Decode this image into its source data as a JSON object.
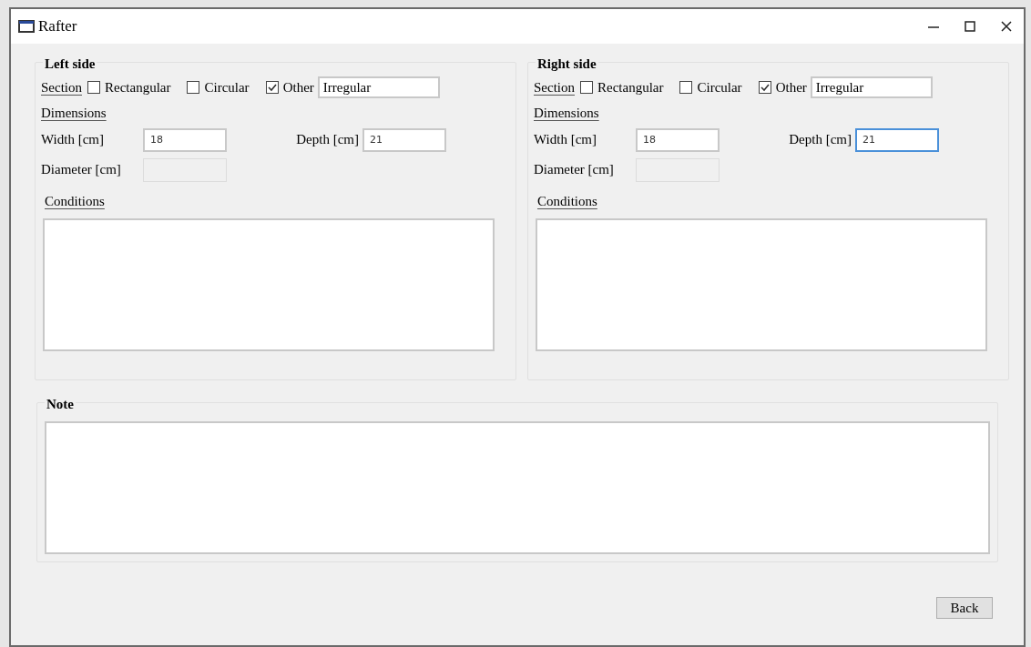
{
  "window": {
    "title": "Rafter"
  },
  "sides": [
    {
      "title": "Left side",
      "section_label": "Section",
      "options": [
        {
          "label": "Rectangular",
          "checked": false
        },
        {
          "label": "Circular",
          "checked": false
        },
        {
          "label": "Other",
          "checked": true
        }
      ],
      "other_value": "Irregular",
      "dimensions_label": "Dimensions",
      "width_label": "Width [cm]",
      "width_value": "18",
      "depth_label": "Depth [cm]",
      "depth_value": "21",
      "depth_focused": false,
      "diameter_label": "Diameter [cm]",
      "conditions_label": "Conditions"
    },
    {
      "title": "Right side",
      "section_label": "Section",
      "options": [
        {
          "label": "Rectangular",
          "checked": false
        },
        {
          "label": "Circular",
          "checked": false
        },
        {
          "label": "Other",
          "checked": true
        }
      ],
      "other_value": "Irregular",
      "dimensions_label": "Dimensions",
      "width_label": "Width [cm]",
      "width_value": "18",
      "depth_label": "Depth [cm]",
      "depth_value": "21",
      "depth_focused": true,
      "diameter_label": "Diameter [cm]",
      "conditions_label": "Conditions"
    }
  ],
  "note": {
    "title": "Note"
  },
  "back_button": "Back"
}
